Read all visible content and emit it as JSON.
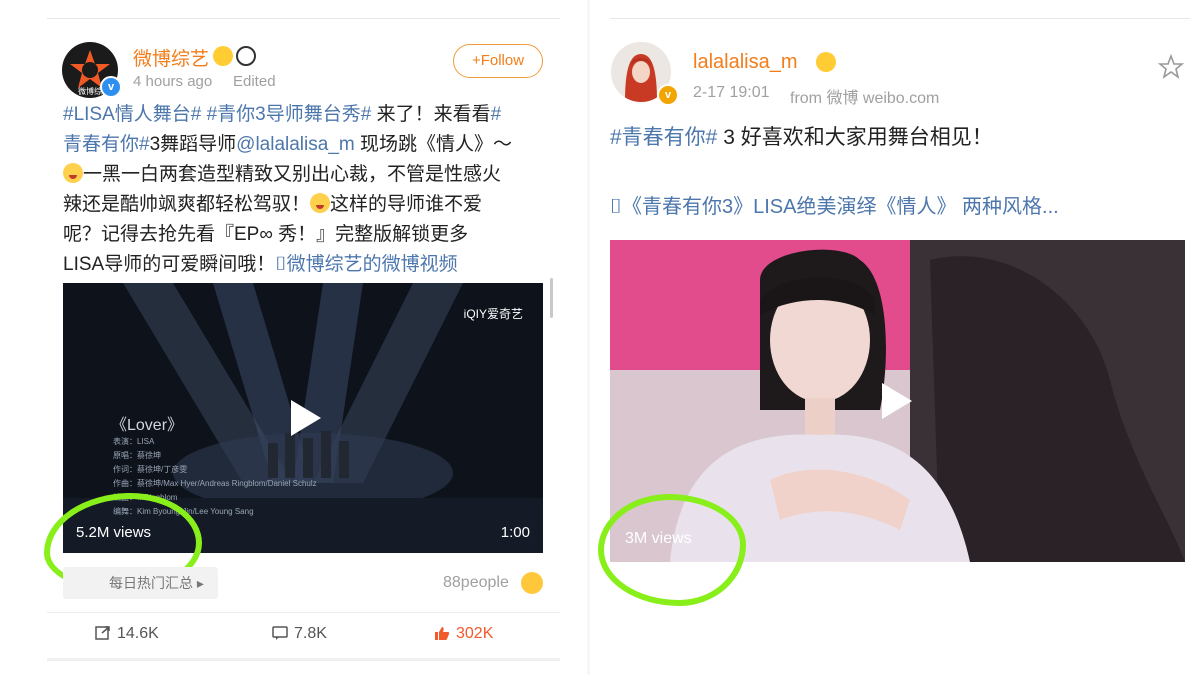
{
  "left_post": {
    "author": "微博综艺",
    "time": "4 hours ago",
    "edited": "Edited",
    "follow_label": "+Follow",
    "text_lines": [
      [
        {
          "t": "#LISA情人舞台#",
          "topic": true
        },
        {
          "t": " "
        },
        {
          "t": "#青你3导师舞台秀#",
          "topic": true
        },
        {
          "t": " 来了！来看看"
        },
        {
          "t": "#",
          "topic": true
        }
      ],
      [
        {
          "t": "青春有你#",
          "topic": true
        },
        {
          "t": "3舞蹈导师"
        },
        {
          "t": "@lalalalisa_m",
          "topic": true
        },
        {
          "t": " 现场跳《情人》～"
        }
      ],
      [
        {
          "t": "EMOJI"
        },
        {
          "t": "一黑一白两套造型精致又别出心裁，不管是性感火"
        }
      ],
      [
        {
          "t": "辣还是酷帅飒爽都轻松驾驭！"
        },
        {
          "t": "EMOJI"
        },
        {
          "t": "这样的导师谁不爱"
        }
      ],
      [
        {
          "t": "呢？记得去抢先看『EP∞ 秀！』完整版解锁更多"
        }
      ],
      [
        {
          "t": "LISA导师的可爱瞬间哦！"
        },
        {
          "t": "⌷微博综艺的微博视频",
          "topic": true
        }
      ]
    ],
    "video": {
      "watermark": "iQIY爱奇艺",
      "song_title": "《Lover》",
      "credits": [
        "表演：LISA",
        "原唱：蔡徐坤",
        "作词：蔡徐坤/丁彦雯",
        "作曲：蔡徐坤/Max Hyer/Andreas Ringblom/Daniel Schulz",
        "编曲：...Ringblom",
        "编舞：Kim Byoung Jin/Lee Young Sang"
      ],
      "views": "5.2M views",
      "duration": "1:00"
    },
    "collection_label": "每日热门汇总",
    "people": "88people",
    "actions": {
      "repost": "14.6K",
      "comment": "7.8K",
      "like": "302K"
    }
  },
  "right_post": {
    "author": "lalalalisa_m",
    "time": "2-17 19:01",
    "source": "from 微博 weibo.com",
    "topic": "#青春有你#",
    "text": " 3 好喜欢和大家用舞台相见！",
    "video_link": "《青春有你3》LISA绝美演绎《情人》 两种风格...",
    "views": "3M views"
  },
  "colors": {
    "accent": "#f27d1a",
    "topic": "#4d77ac",
    "highlight": "#88ef1a",
    "like": "#f25a2a"
  }
}
